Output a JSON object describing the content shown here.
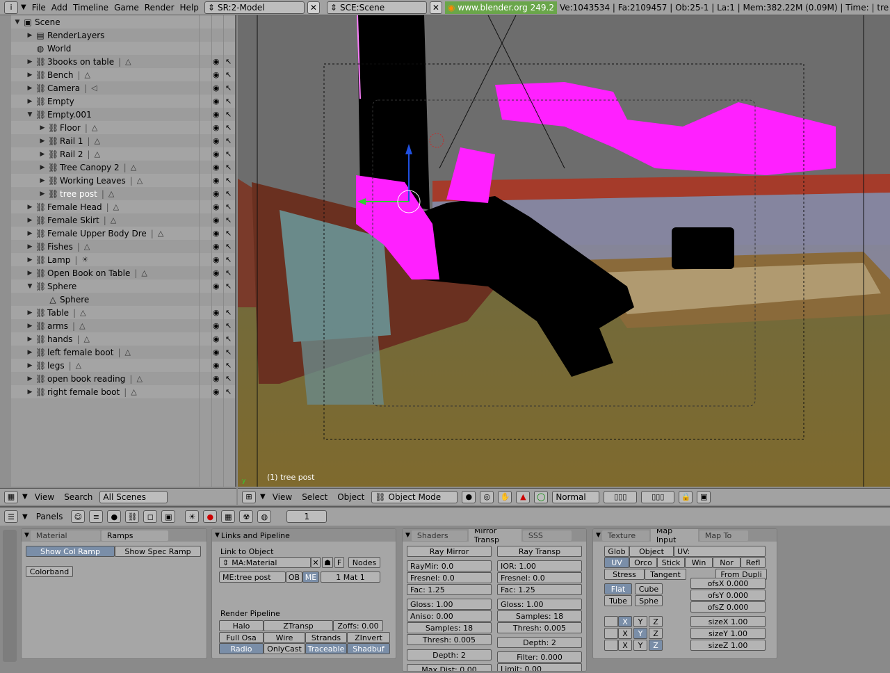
{
  "topbar": {
    "menu": [
      "File",
      "Add",
      "Timeline",
      "Game",
      "Render",
      "Help"
    ],
    "screen": "SR:2-Model",
    "scene": "SCE:Scene",
    "url": "www.blender.org 249.2",
    "stats": "Ve:1043534 | Fa:2109457 | Ob:25-1 | La:1  | Mem:382.22M (0.09M) | Time: | tre"
  },
  "outliner": {
    "rows": [
      {
        "label": "Scene",
        "indent": 0,
        "expand": "open",
        "icon": "scene"
      },
      {
        "label": "RenderLayers",
        "indent": 1,
        "expand": "closed",
        "icon": "render"
      },
      {
        "label": "World",
        "indent": 1,
        "expand": "none",
        "icon": "world"
      },
      {
        "label": "3books on table",
        "indent": 1,
        "expand": "closed",
        "icon": "object",
        "data": "mesh"
      },
      {
        "label": "Bench",
        "indent": 1,
        "expand": "closed",
        "icon": "object",
        "data": "mesh"
      },
      {
        "label": "Camera",
        "indent": 1,
        "expand": "closed",
        "icon": "object",
        "data": "camera"
      },
      {
        "label": "Empty",
        "indent": 1,
        "expand": "closed",
        "icon": "object"
      },
      {
        "label": "Empty.001",
        "indent": 1,
        "expand": "open",
        "icon": "object"
      },
      {
        "label": "Floor",
        "indent": 2,
        "expand": "closed",
        "icon": "object",
        "data": "mesh"
      },
      {
        "label": "Rail 1",
        "indent": 2,
        "expand": "closed",
        "icon": "object",
        "data": "mesh"
      },
      {
        "label": "Rail 2",
        "indent": 2,
        "expand": "closed",
        "icon": "object",
        "data": "mesh"
      },
      {
        "label": "Tree Canopy 2",
        "indent": 2,
        "expand": "closed",
        "icon": "object",
        "data": "mesh"
      },
      {
        "label": "Working Leaves",
        "indent": 2,
        "expand": "closed",
        "icon": "object",
        "data": "mesh"
      },
      {
        "label": "tree post",
        "indent": 2,
        "expand": "closed",
        "icon": "object",
        "data": "mesh",
        "selected": true
      },
      {
        "label": "Female Head",
        "indent": 1,
        "expand": "closed",
        "icon": "object",
        "data": "mesh"
      },
      {
        "label": "Female Skirt",
        "indent": 1,
        "expand": "closed",
        "icon": "object",
        "data": "mesh"
      },
      {
        "label": "Female Upper Body Dre",
        "indent": 1,
        "expand": "closed",
        "icon": "object",
        "data": "mesh"
      },
      {
        "label": "Fishes",
        "indent": 1,
        "expand": "closed",
        "icon": "object",
        "data": "mesh"
      },
      {
        "label": "Lamp",
        "indent": 1,
        "expand": "closed",
        "icon": "object",
        "data": "lamp"
      },
      {
        "label": "Open Book on Table",
        "indent": 1,
        "expand": "closed",
        "icon": "object",
        "data": "mesh"
      },
      {
        "label": "Sphere",
        "indent": 1,
        "expand": "open",
        "icon": "object"
      },
      {
        "label": "Sphere",
        "indent": 2,
        "expand": "none",
        "icon": "mesh"
      },
      {
        "label": "Table",
        "indent": 1,
        "expand": "closed",
        "icon": "object",
        "data": "mesh"
      },
      {
        "label": "arms",
        "indent": 1,
        "expand": "closed",
        "icon": "object",
        "data": "mesh"
      },
      {
        "label": "hands",
        "indent": 1,
        "expand": "closed",
        "icon": "object",
        "data": "mesh"
      },
      {
        "label": "left female boot",
        "indent": 1,
        "expand": "closed",
        "icon": "object",
        "data": "mesh"
      },
      {
        "label": "legs",
        "indent": 1,
        "expand": "closed",
        "icon": "object",
        "data": "mesh"
      },
      {
        "label": "open book reading",
        "indent": 1,
        "expand": "closed",
        "icon": "object",
        "data": "mesh"
      },
      {
        "label": "right female boot",
        "indent": 1,
        "expand": "closed",
        "icon": "object",
        "data": "mesh"
      }
    ]
  },
  "outliner_header": {
    "view": "View",
    "search": "Search",
    "scenes": "All Scenes"
  },
  "viewport": {
    "label": "(1) tree post"
  },
  "viewport_header": {
    "view": "View",
    "select": "Select",
    "object": "Object",
    "mode": "Object Mode",
    "shading": "Normal"
  },
  "buttons_header": {
    "panels": "Panels",
    "frame": "1"
  },
  "material_panel": {
    "tabs": [
      "Material",
      "Ramps"
    ],
    "show_col_ramp": "Show Col Ramp",
    "show_spec_ramp": "Show Spec Ramp",
    "colorband": "Colorband"
  },
  "links_panel": {
    "title": "Links and Pipeline",
    "link_to_object": "Link to Object",
    "material": "MA:Material",
    "f": "F",
    "nodes": "Nodes",
    "mesh": "ME:tree post",
    "ob": "OB",
    "me": "ME",
    "mat": "1 Mat 1",
    "render_pipeline": "Render Pipeline",
    "halo": "Halo",
    "ztransp": "ZTransp",
    "zoffs": "Zoffs: 0.00",
    "full_osa": "Full Osa",
    "wire": "Wire",
    "strands": "Strands",
    "zinvert": "ZInvert",
    "radio": "Radio",
    "onlycast": "OnlyCast",
    "traceable": "Traceable",
    "shadbuf": "Shadbuf"
  },
  "shaders_panel": {
    "tabs": [
      "Shaders",
      "Mirror Transp",
      "SSS"
    ],
    "ray_mirror": "Ray Mirror",
    "ray_transp": "Ray Transp",
    "raymir": "RayMir: 0.0",
    "fresnel1": "Fresnel: 0.0",
    "fac1": "Fac: 1.25",
    "gloss1": "Gloss: 1.00",
    "aniso": "Aniso: 0.00",
    "samples1": "Samples: 18",
    "thresh1": "Thresh: 0.005",
    "depth1": "Depth: 2",
    "maxdist": "Max Dist: 0.00",
    "ior": "IOR: 1.00",
    "fresnel2": "Fresnel: 0.0",
    "fac2": "Fac: 1.25",
    "gloss2": "Gloss: 1.00",
    "samples2": "Samples: 18",
    "thresh2": "Thresh: 0.005",
    "depth2": "Depth: 2",
    "filter": "Filter: 0.000",
    "limit": "Limit: 0.00"
  },
  "texture_panel": {
    "tabs": [
      "Texture",
      "Map Input",
      "Map To"
    ],
    "glob": "Glob",
    "object": "Object",
    "uv_label": "UV:",
    "uv": "UV",
    "orco": "Orco",
    "stick": "Stick",
    "win": "Win",
    "nor": "Nor",
    "refl": "Refl",
    "stress": "Stress",
    "tangent": "Tangent",
    "from_dupli": "From Dupli",
    "flat": "Flat",
    "cube": "Cube",
    "tube": "Tube",
    "sphe": "Sphe",
    "ofsx": "ofsX 0.000",
    "ofsy": "ofsY 0.000",
    "ofsz": "ofsZ 0.000",
    "sizex": "sizeX 1.00",
    "sizey": "sizeY 1.00",
    "sizez": "sizeZ 1.00",
    "x": "X",
    "y": "Y",
    "z": "Z"
  }
}
